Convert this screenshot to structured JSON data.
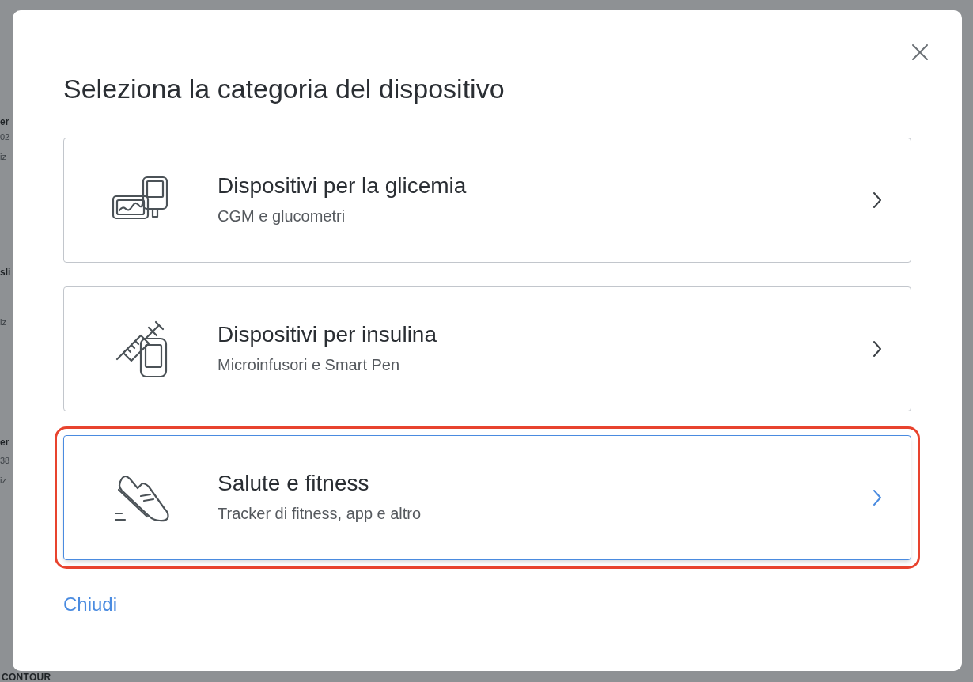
{
  "background": {
    "fragments": [
      {
        "kind": "heading",
        "text": "er"
      },
      {
        "kind": "line",
        "text": "02"
      },
      {
        "kind": "line",
        "text": "iz"
      },
      {
        "kind": "heading",
        "text": "sli"
      },
      {
        "kind": "line",
        "text": "iz"
      },
      {
        "kind": "heading",
        "text": "er"
      },
      {
        "kind": "line",
        "text": "38"
      },
      {
        "kind": "line",
        "text": "iz"
      }
    ],
    "footer_text": "CONTOUR"
  },
  "dialog": {
    "title": "Seleziona la categoria del dispositivo",
    "options": [
      {
        "kind": "meter",
        "title": "Dispositivi per la glicemia",
        "subtitle": "CGM e glucometri",
        "selected": false
      },
      {
        "kind": "syringe",
        "title": "Dispositivi per insulina",
        "subtitle": "Microinfusori e Smart Pen",
        "selected": false
      },
      {
        "kind": "shoe",
        "title": "Salute e fitness",
        "subtitle": "Tracker di fitness, app e altro",
        "selected": true
      }
    ],
    "close_link": "Chiudi"
  }
}
